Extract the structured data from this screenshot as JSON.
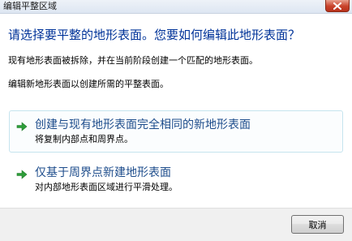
{
  "window": {
    "title": "编辑平整区域"
  },
  "dialog": {
    "main_instruction": "请选择要平整的地形表面。您要如何编辑此地形表面？",
    "content_line_1": "现有地形表面被拆除，并在当前阶段创建一个匹配的地形表面。",
    "content_line_2": "编辑新地形表面以创建所需的平整表面。"
  },
  "options": [
    {
      "title": "创建与现有地形表面完全相同的新地形表面",
      "description": "将复制内部点和周界点。",
      "icon": "green-arrow-icon"
    },
    {
      "title": "仅基于周界点新建地形表面",
      "description": "对内部地形表面区域进行平滑处理。",
      "icon": "green-arrow-icon"
    }
  ],
  "footer": {
    "cancel_label": "取消"
  },
  "colors": {
    "main_instruction": "#003399",
    "command_link": "#1e4d8c",
    "arrow": "#2e9e3a",
    "close_button": "#c8422a"
  }
}
